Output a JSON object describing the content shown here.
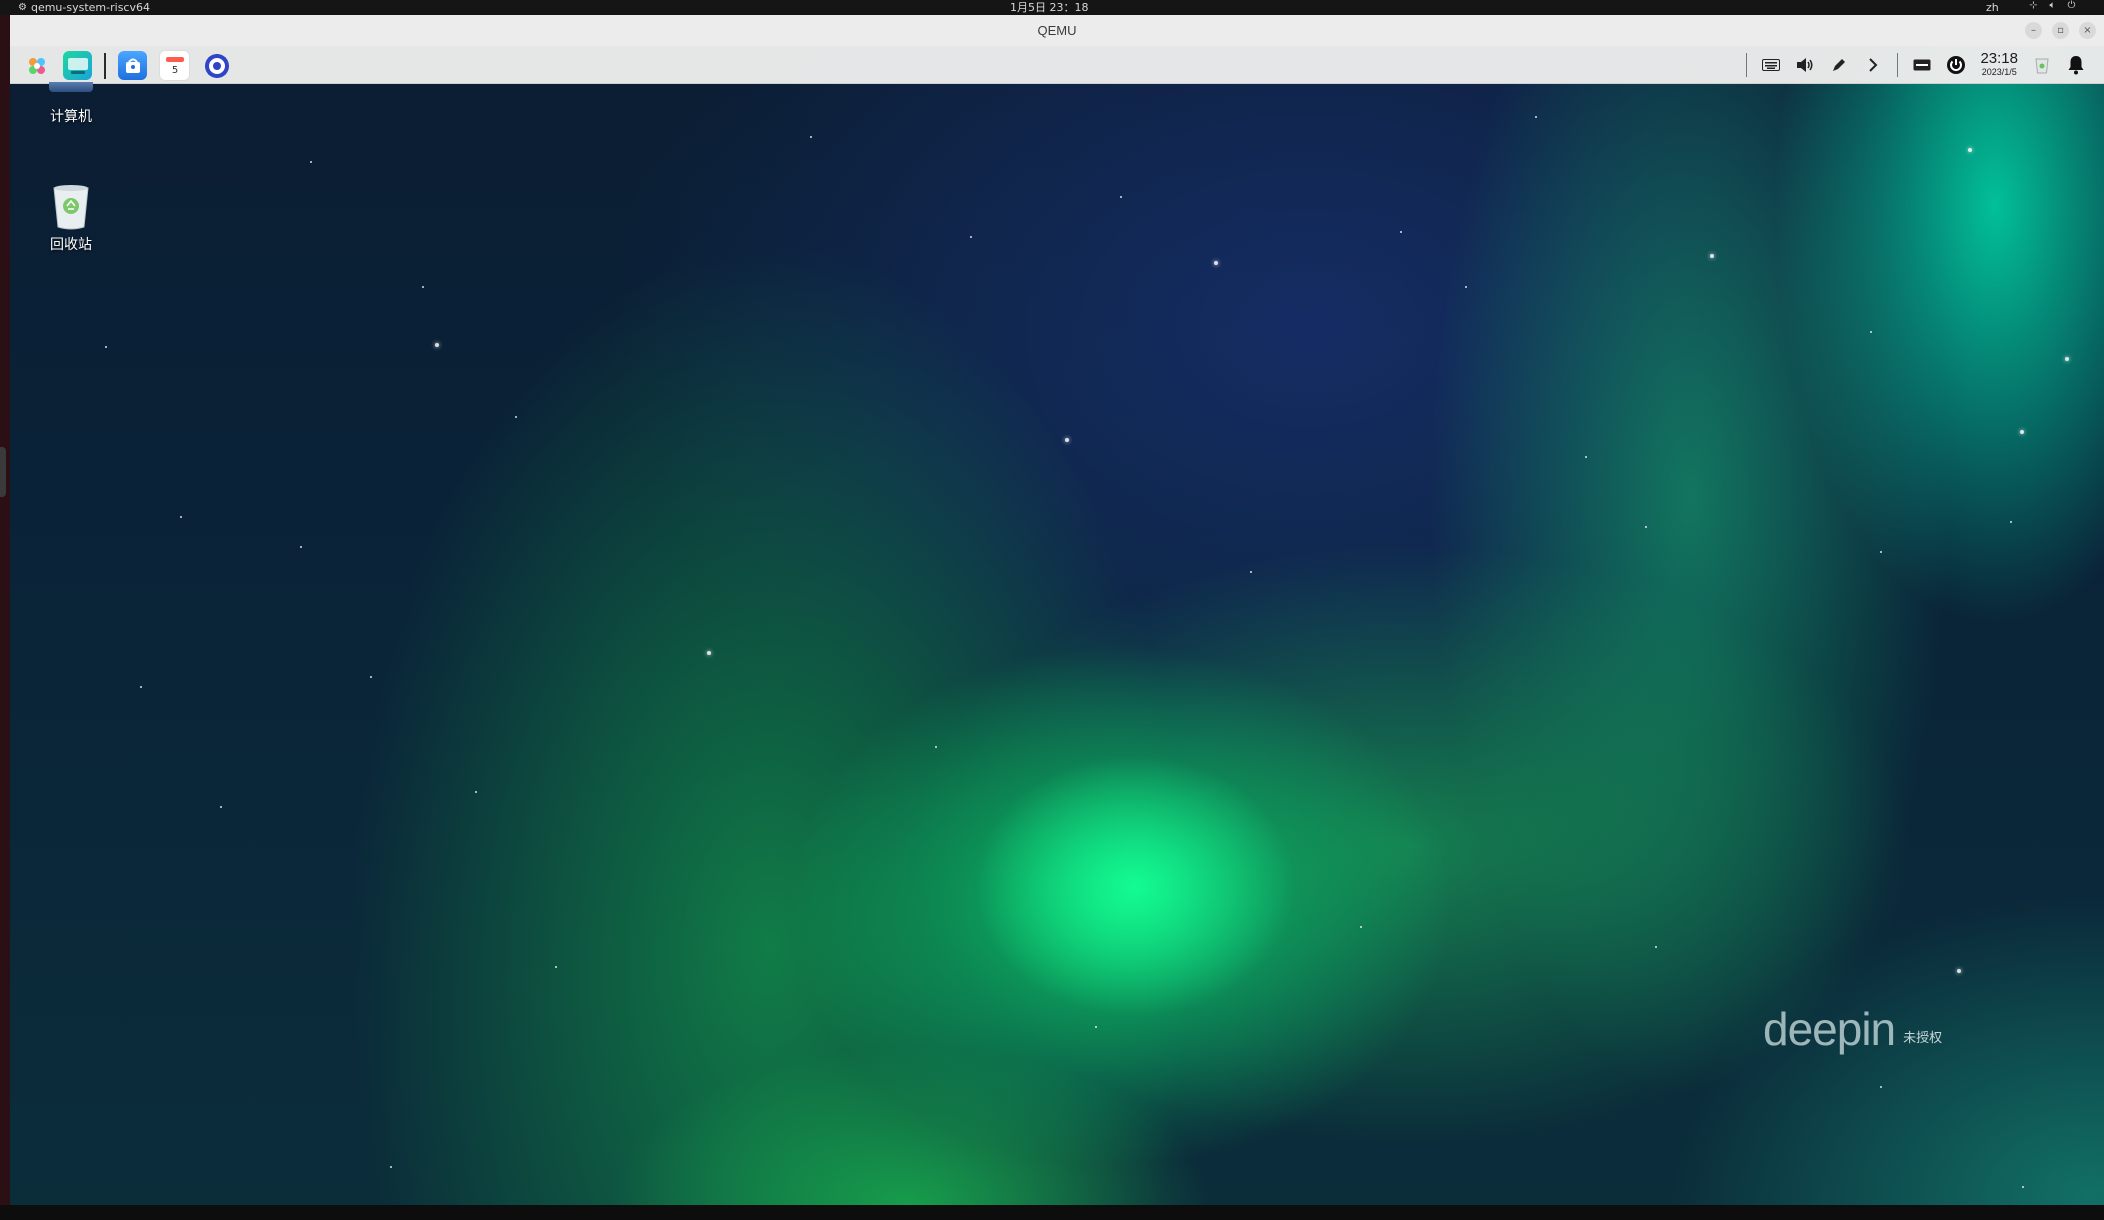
{
  "host": {
    "app_name": "qemu-system-riscv64",
    "clock": "1月5日 23：18",
    "lang": "zh"
  },
  "window": {
    "title": "QEMU",
    "controls": [
      "–",
      "▫",
      "×"
    ]
  },
  "dock": {
    "apps": [
      {
        "name": "launcher-icon"
      },
      {
        "name": "multitask-view-icon"
      },
      {
        "name": "app-store-icon"
      },
      {
        "name": "calendar-icon",
        "day": "5"
      },
      {
        "name": "control-center-icon"
      }
    ],
    "tray": {
      "time": "23:18",
      "date": "2023/1/5"
    }
  },
  "desktop": {
    "icons": [
      {
        "label": "计算机"
      },
      {
        "label": "回收站"
      }
    ],
    "watermark": {
      "logo": "deepin",
      "text": "未授权"
    }
  },
  "colors": {
    "aurora_green": "#14ff96",
    "sky_dark": "#0b1d33",
    "dock_bg": "#ececec"
  }
}
